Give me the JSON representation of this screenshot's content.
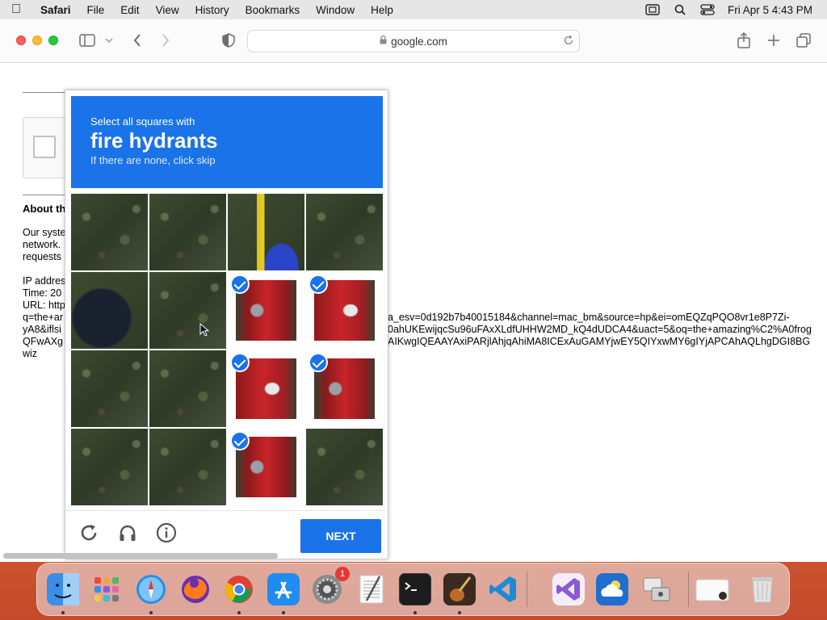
{
  "menubar": {
    "app_name": "Safari",
    "items": [
      "File",
      "Edit",
      "View",
      "History",
      "Bookmarks",
      "Window",
      "Help"
    ],
    "clock": "Fri Apr 5  4:43 PM"
  },
  "browser": {
    "url": "google.com"
  },
  "page": {
    "about_title": "About th",
    "paragraph1": [
      "Our syste",
      "network.",
      "requests"
    ],
    "ip_label": "IP addres",
    "time_label": "Time: 20",
    "url_label": "URL: http",
    "url_fragments": [
      "q=the+ar",
      "yA8&iflsi",
      "QFwAXg",
      "wiz"
    ],
    "long_url_lines": [
      "a_esv=0d192b7b40015184&channel=mac_bm&source=hp&ei=omEQZqPQO8vr1e8P7Zi-",
      "0ahUKEwijqcSu96uFAxXLdfUHHW2MD_kQ4dUDCA4&uact=5&oq=the+amazing%C2%A0frog",
      "AIKwgIQEAAYAxiPARjlAhjqAhiMA8ICExAuGAMYjwEY5QIYxwMY6gIYjAPCAhAQLhgDGI8BG"
    ]
  },
  "captcha": {
    "instruction": "Select all squares with",
    "target": "fire hydrants",
    "subtext": "If there are none, click skip",
    "next_label": "NEXT",
    "tiles": [
      {
        "row": 0,
        "col": 0,
        "selected": false,
        "content": "grass"
      },
      {
        "row": 0,
        "col": 1,
        "selected": false,
        "content": "grass"
      },
      {
        "row": 0,
        "col": 2,
        "selected": false,
        "content": "hydrant-top"
      },
      {
        "row": 0,
        "col": 3,
        "selected": false,
        "content": "grass"
      },
      {
        "row": 1,
        "col": 0,
        "selected": false,
        "content": "dark-obj"
      },
      {
        "row": 1,
        "col": 1,
        "selected": false,
        "content": "grass"
      },
      {
        "row": 1,
        "col": 2,
        "selected": true,
        "content": "hydrant-red"
      },
      {
        "row": 1,
        "col": 3,
        "selected": true,
        "content": "hydrant-red2"
      },
      {
        "row": 2,
        "col": 0,
        "selected": false,
        "content": "grass"
      },
      {
        "row": 2,
        "col": 1,
        "selected": false,
        "content": "grass"
      },
      {
        "row": 2,
        "col": 2,
        "selected": true,
        "content": "hydrant-red2"
      },
      {
        "row": 2,
        "col": 3,
        "selected": true,
        "content": "hydrant-red"
      },
      {
        "row": 3,
        "col": 0,
        "selected": false,
        "content": "grass"
      },
      {
        "row": 3,
        "col": 1,
        "selected": false,
        "content": "grass"
      },
      {
        "row": 3,
        "col": 2,
        "selected": true,
        "content": "hydrant-red"
      },
      {
        "row": 3,
        "col": 3,
        "selected": false,
        "content": "grass"
      }
    ]
  },
  "dock": {
    "apps": [
      {
        "name": "finder",
        "running": true,
        "color": "#3b8ee6"
      },
      {
        "name": "launchpad",
        "running": false,
        "color": "#f2f2f2"
      },
      {
        "name": "safari",
        "running": true,
        "color": "#e8f1fb"
      },
      {
        "name": "firefox",
        "running": false,
        "color": "#5a2ca0"
      },
      {
        "name": "chrome",
        "running": true,
        "color": "#ffffff"
      },
      {
        "name": "app-store",
        "running": true,
        "color": "#1e8cf0"
      },
      {
        "name": "system-settings",
        "running": false,
        "color": "#8a8a8a",
        "badge": "1"
      },
      {
        "name": "textedit",
        "running": false,
        "color": "#f5f5f5"
      },
      {
        "name": "terminal",
        "running": true,
        "color": "#1c1c1c"
      },
      {
        "name": "instruments",
        "running": true,
        "color": "#3a2a20"
      },
      {
        "name": "vscode",
        "running": false,
        "color": "#ffffff"
      },
      {
        "name": "visual-studio",
        "running": false,
        "color": "#f3eefa"
      },
      {
        "name": "cloud-app",
        "running": false,
        "color": "#1f6fd1"
      },
      {
        "name": "migration-assistant",
        "running": false,
        "color": "#dcdcdc"
      },
      {
        "name": "preview-window",
        "running": false,
        "color": "#f0f0f0"
      },
      {
        "name": "trash",
        "running": false,
        "color": "#e6e6e6"
      }
    ]
  },
  "colors": {
    "accent": "#1a73e8",
    "traffic_red": "#fe5f57",
    "traffic_yellow": "#febc2e",
    "traffic_green": "#28c840"
  }
}
